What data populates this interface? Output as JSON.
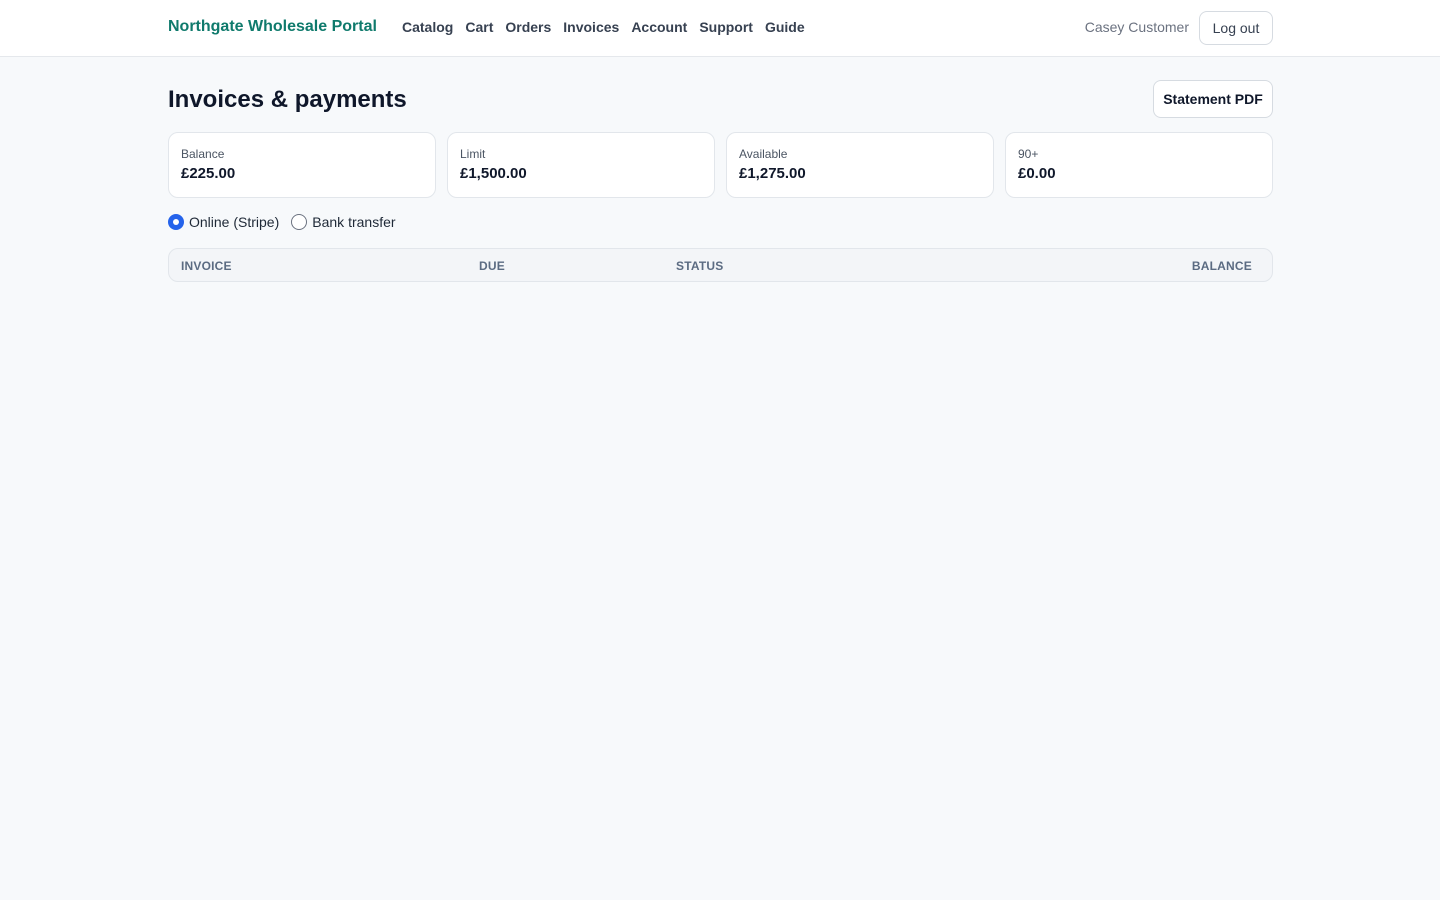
{
  "header": {
    "brand": "Northgate Wholesale Portal",
    "nav": [
      "Catalog",
      "Cart",
      "Orders",
      "Invoices",
      "Account",
      "Support",
      "Guide"
    ],
    "user": "Casey Customer",
    "logout_label": "Log out"
  },
  "page": {
    "title": "Invoices & payments",
    "statement_label": "Statement PDF"
  },
  "summary": [
    {
      "label": "Balance",
      "value": "£225.00"
    },
    {
      "label": "Limit",
      "value": "£1,500.00"
    },
    {
      "label": "Available",
      "value": "£1,275.00"
    },
    {
      "label": "90+",
      "value": "£0.00"
    }
  ],
  "payment_methods": {
    "options": [
      "Online (Stripe)",
      "Bank transfer"
    ],
    "selected": "Online (Stripe)"
  },
  "table": {
    "columns": [
      "INVOICE",
      "DUE",
      "STATUS",
      "BALANCE"
    ],
    "rows": []
  },
  "colors": {
    "brand": "#0f7a6c",
    "accent": "#2563eb",
    "background": "#f7f9fb"
  }
}
